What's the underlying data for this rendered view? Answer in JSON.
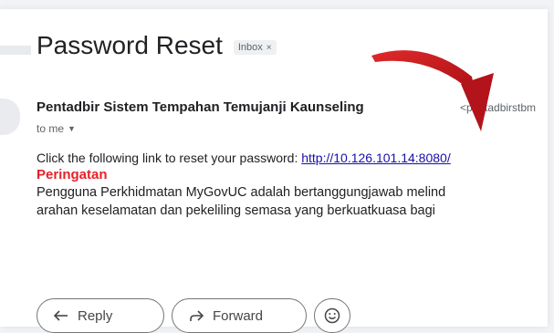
{
  "email": {
    "subject": "Password Reset",
    "label_chip": "Inbox",
    "sender_name": "Pentadbir Sistem Tempahan Temujanji Kaunseling",
    "sender_email": "<pentadbirstbm",
    "recipient": "to me",
    "body": {
      "line1_text": "Click the following link to reset your password: ",
      "line1_link": "http://10.126.101.14:8080/",
      "warning_title": "Peringatan",
      "line3": "Pengguna Perkhidmatan MyGovUC adalah bertanggungjawab melind",
      "line4": "arahan keselamatan dan pekeliling semasa yang berkuatkuasa bagi"
    }
  },
  "actions": {
    "reply_label": "Reply",
    "forward_label": "Forward"
  },
  "icons": [
    "close-icon",
    "chevron-down-icon",
    "reply-icon",
    "forward-icon",
    "emoji-icon",
    "red-arrow-annotation"
  ],
  "colors": {
    "warning": "#e8202a",
    "link": "#1a0dab",
    "annotation_arrow": "#c8161d"
  }
}
